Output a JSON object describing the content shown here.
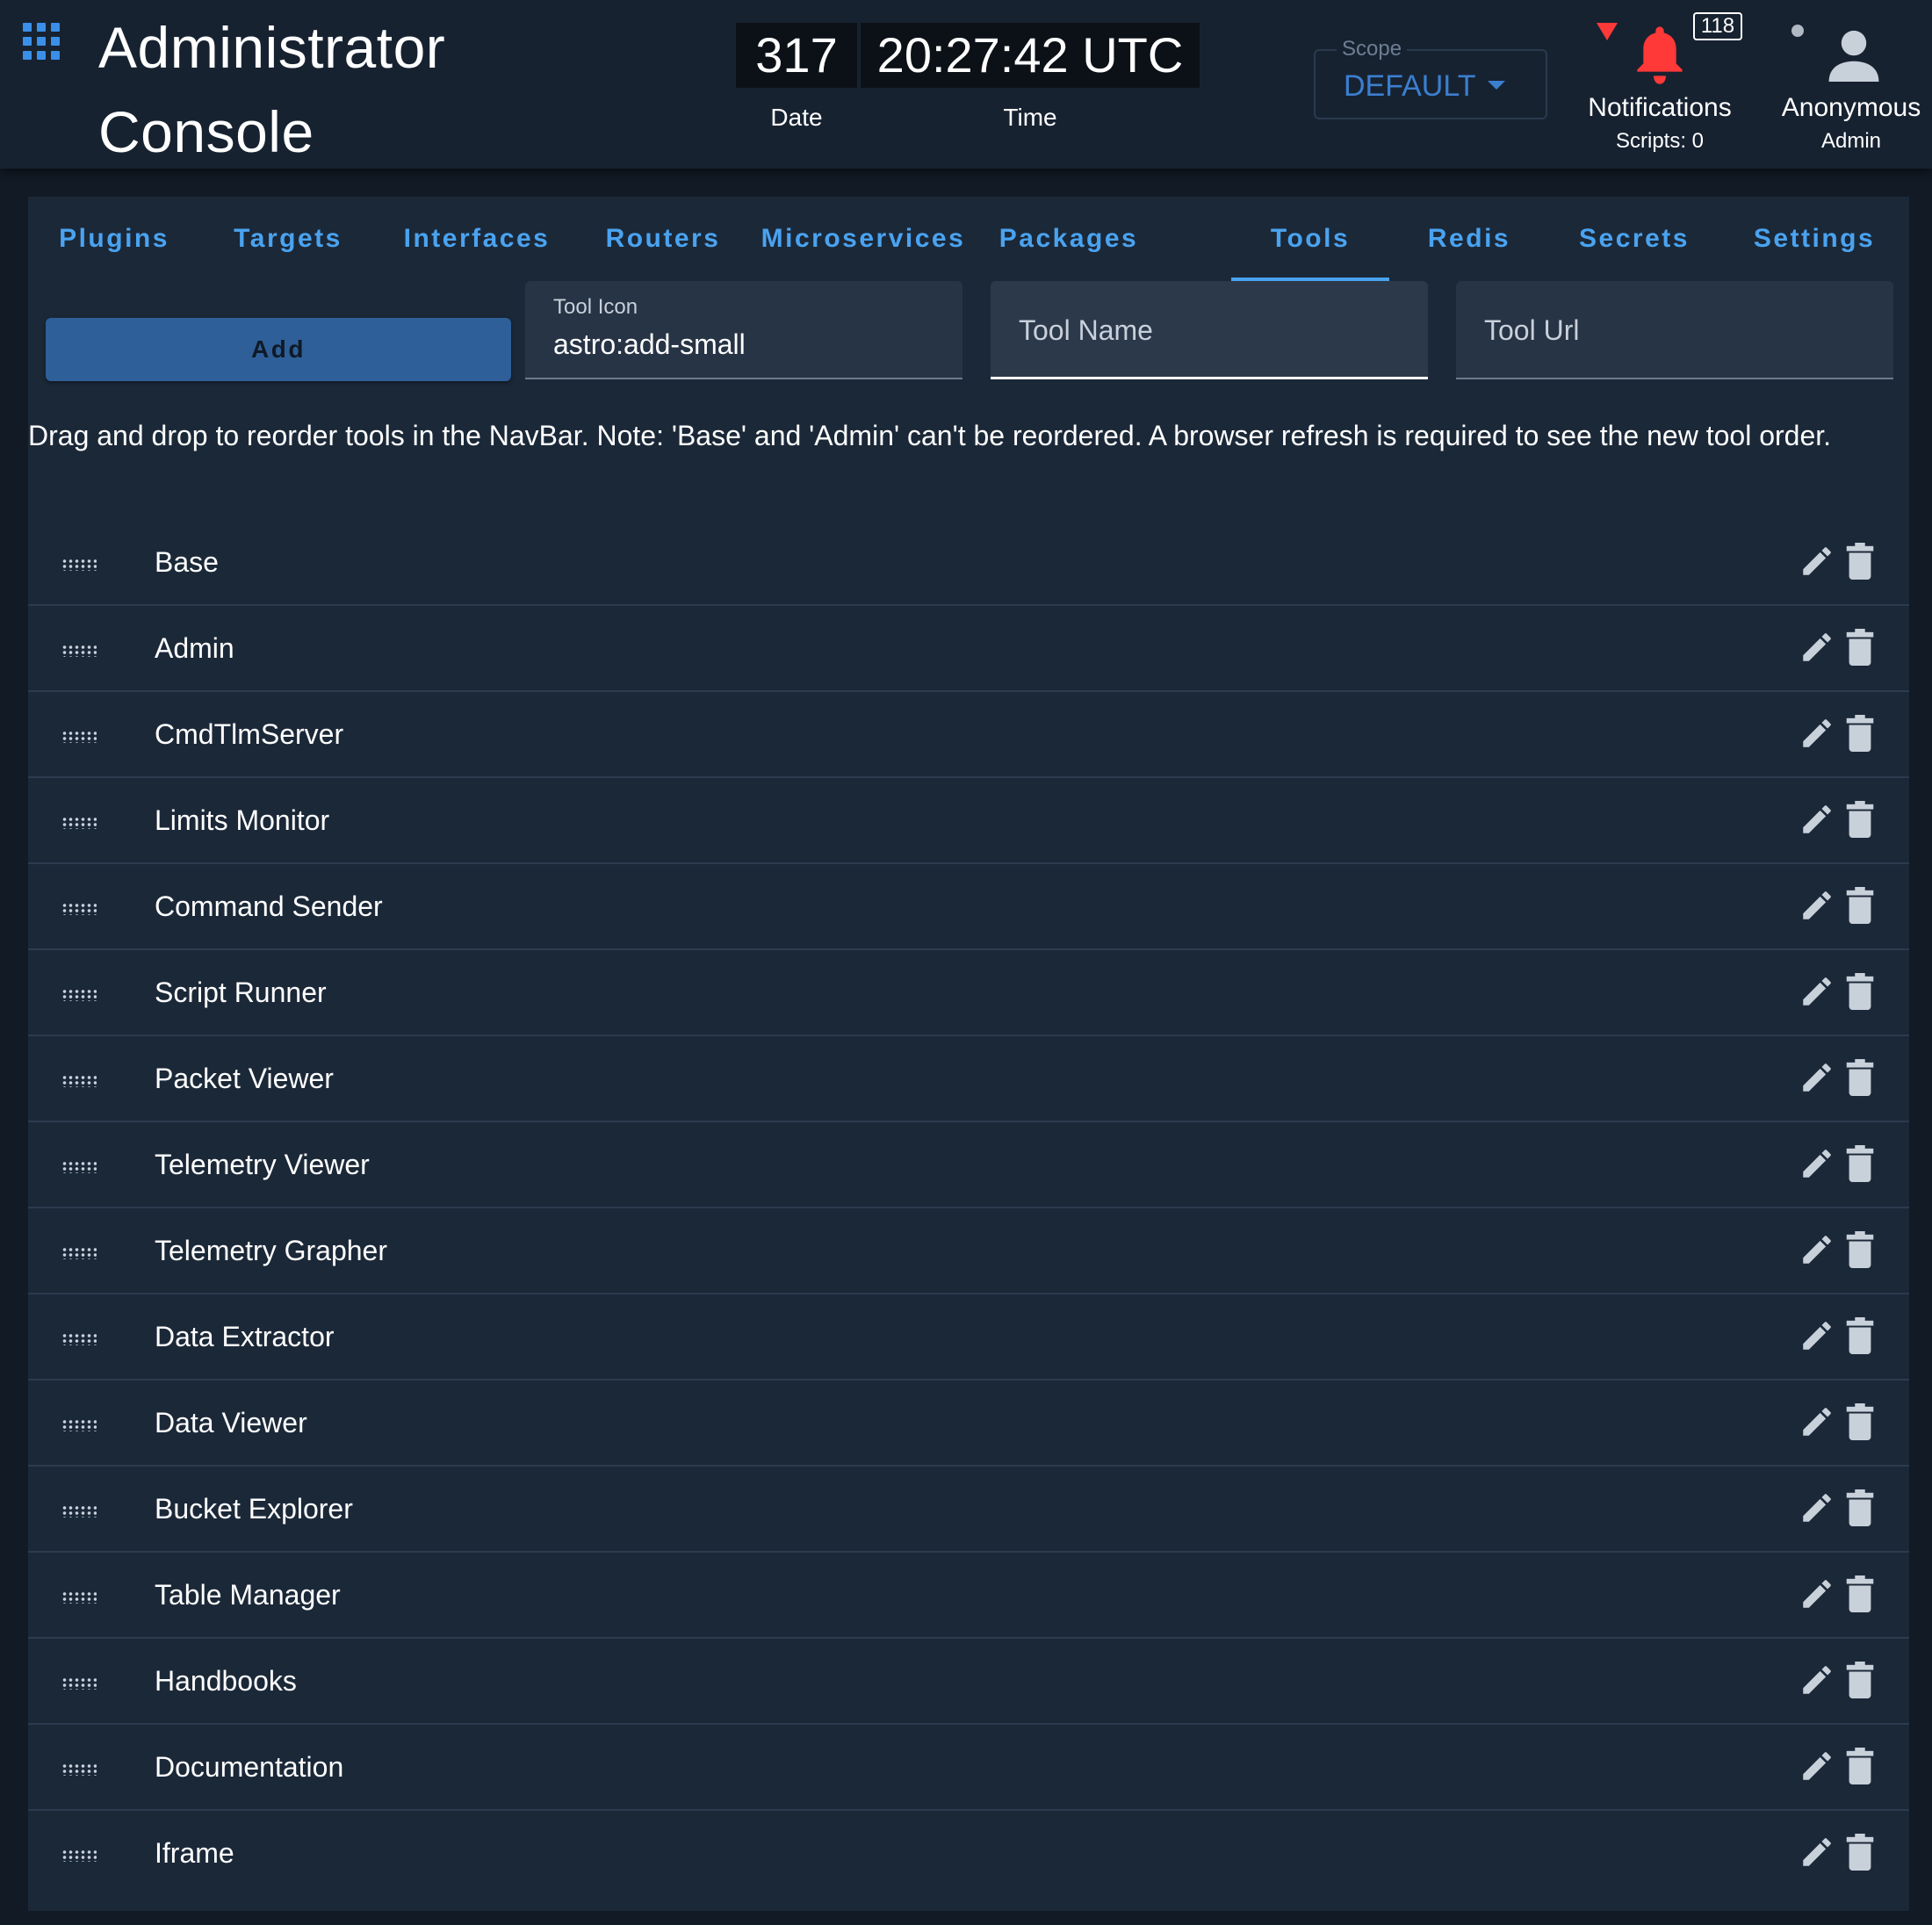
{
  "header": {
    "title_line1": "Administrator",
    "title_line2": "Console",
    "date_value": "317",
    "time_value": "20:27:42 UTC",
    "date_label": "Date",
    "time_label": "Time",
    "scope_label": "Scope",
    "scope_value": "DEFAULT",
    "notifications_count": "118",
    "notifications_label": "Notifications",
    "scripts_label": "Scripts: 0",
    "user_name": "Anonymous",
    "user_role": "Admin",
    "colors": {
      "accent": "#4aa3f0",
      "alert": "#ff3838",
      "bell": "#ff3838"
    },
    "icons": [
      "apps-grid-icon",
      "alert-triangle-icon",
      "bell-icon",
      "user-icon"
    ]
  },
  "tabs": [
    {
      "label": "Plugins"
    },
    {
      "label": "Targets"
    },
    {
      "label": "Interfaces"
    },
    {
      "label": "Routers"
    },
    {
      "label": "Microservices"
    },
    {
      "label": "Packages"
    },
    {
      "label": "Tools",
      "active": true
    },
    {
      "label": "Redis"
    },
    {
      "label": "Secrets"
    },
    {
      "label": "Settings"
    }
  ],
  "form": {
    "add_label": "Add",
    "tool_icon_label": "Tool Icon",
    "tool_icon_value": "astro:add-small",
    "tool_name_placeholder": "Tool Name",
    "tool_url_placeholder": "Tool Url"
  },
  "help_text": "Drag and drop to reorder tools in the NavBar. Note: 'Base' and 'Admin' can't be reordered. A browser refresh is required to see the new tool order.",
  "tools": [
    {
      "name": "Base"
    },
    {
      "name": "Admin"
    },
    {
      "name": "CmdTlmServer"
    },
    {
      "name": "Limits Monitor"
    },
    {
      "name": "Command Sender"
    },
    {
      "name": "Script Runner"
    },
    {
      "name": "Packet Viewer"
    },
    {
      "name": "Telemetry Viewer"
    },
    {
      "name": "Telemetry Grapher"
    },
    {
      "name": "Data Extractor"
    },
    {
      "name": "Data Viewer"
    },
    {
      "name": "Bucket Explorer"
    },
    {
      "name": "Table Manager"
    },
    {
      "name": "Handbooks"
    },
    {
      "name": "Documentation"
    },
    {
      "name": "Iframe"
    }
  ]
}
